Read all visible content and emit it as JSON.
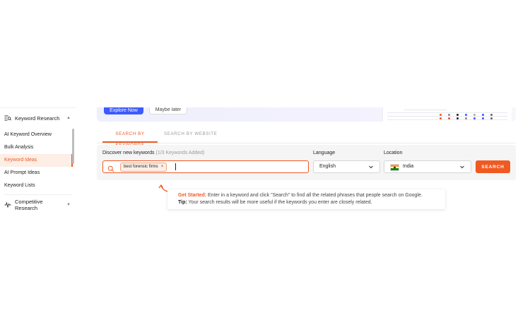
{
  "sidebar": {
    "section_keyword": "Keyword Research",
    "items": [
      {
        "label": "AI Keyword Overview"
      },
      {
        "label": "Bulk Analysis"
      },
      {
        "label": "Keyword Ideas"
      },
      {
        "label": "AI Prompt Ideas"
      },
      {
        "label": "Keyword Lists"
      }
    ],
    "section_competitive": "Competitive Research"
  },
  "banner": {
    "primary_label": "Explore Now",
    "secondary_label": "Maybe later"
  },
  "tabs": [
    {
      "label": "SEARCH BY KEYWORDS"
    },
    {
      "label": "SEARCH BY WEBSITE"
    }
  ],
  "search": {
    "discover_label": "Discover new keywords",
    "keywords_added": "(1/3 Keywords Added)",
    "chip": "best forensic firms",
    "chip_remove": "×",
    "language_label": "Language",
    "language_value": "English",
    "location_label": "Location",
    "location_value": "India",
    "button": "SEARCH"
  },
  "tip": {
    "get_started_key": "Get Started:",
    "get_started_text": " Enter in a keyword and click \"Search\" to find all the related phrases that people search on Google.",
    "tip_key": "Tip:",
    "tip_text": " Your search results will be more useful if the keywords you enter are closely related."
  },
  "colors": {
    "accent": "#f05a22",
    "primary_blue": "#3d5afe"
  }
}
